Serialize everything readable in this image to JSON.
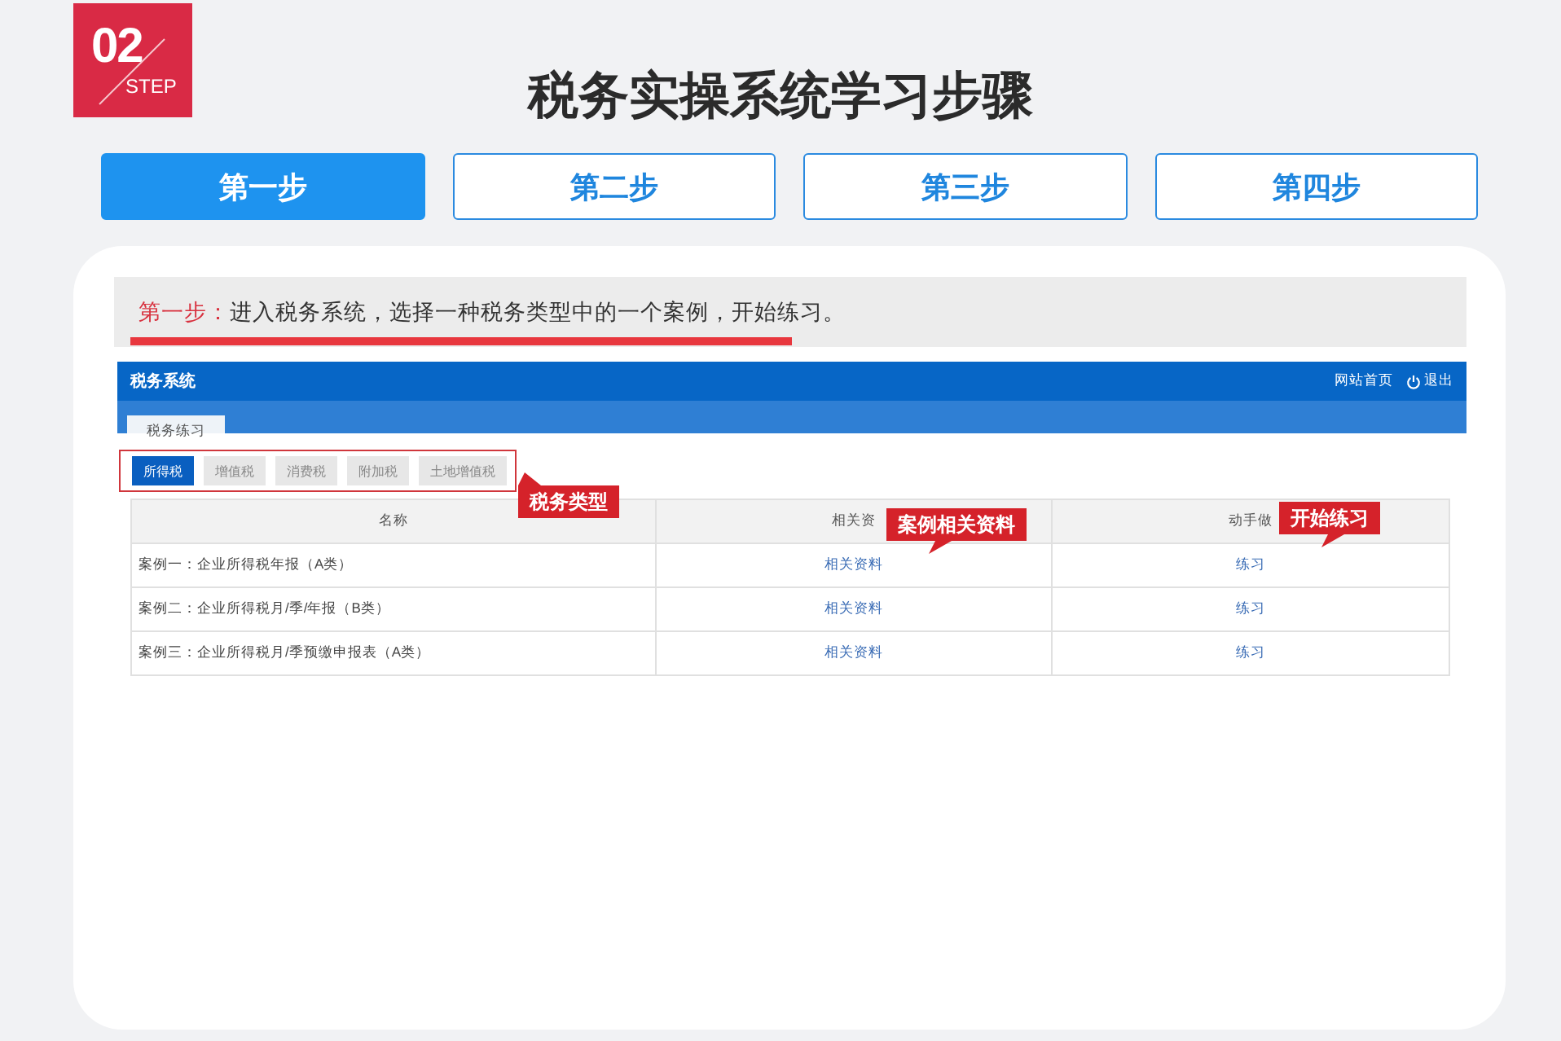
{
  "logo": {
    "number": "02",
    "label": "STEP"
  },
  "title": "税务实操系统学习步骤",
  "steps": [
    {
      "label": "第一步",
      "selected": true
    },
    {
      "label": "第二步",
      "selected": false
    },
    {
      "label": "第三步",
      "selected": false
    },
    {
      "label": "第四步",
      "selected": false
    }
  ],
  "instruction": {
    "label": "第一步：",
    "text": "进入税务系统，选择一种税务类型中的一个案例，开始练习。"
  },
  "system": {
    "title": "税务系统",
    "links": [
      {
        "text": "网站首页",
        "icon": false
      },
      {
        "text": "退出",
        "icon": true
      }
    ],
    "nav_tabs": [
      {
        "label": "税务练习",
        "selected": true
      }
    ],
    "tax_types": [
      {
        "label": "所得税",
        "selected": true
      },
      {
        "label": "增值税",
        "selected": false
      },
      {
        "label": "消费税",
        "selected": false
      },
      {
        "label": "附加税",
        "selected": false
      },
      {
        "label": "土地增值税",
        "selected": false
      }
    ],
    "columns": [
      "名称",
      "相关资",
      "动手做"
    ],
    "rows": [
      {
        "name": "案例一：企业所得税年报（A类）",
        "materials": "相关资料",
        "practice": "练习"
      },
      {
        "name": "案例二：企业所得税月/季/年报（B类）",
        "materials": "相关资料",
        "practice": "练习"
      },
      {
        "name": "案例三：企业所得税月/季预缴申报表（A类）",
        "materials": "相关资料",
        "practice": "练习"
      }
    ],
    "callouts": [
      {
        "text": "税务类型",
        "kind": "up"
      },
      {
        "text": "案例相关资料",
        "kind": "down"
      },
      {
        "text": "开始练习",
        "kind": "down"
      }
    ]
  }
}
